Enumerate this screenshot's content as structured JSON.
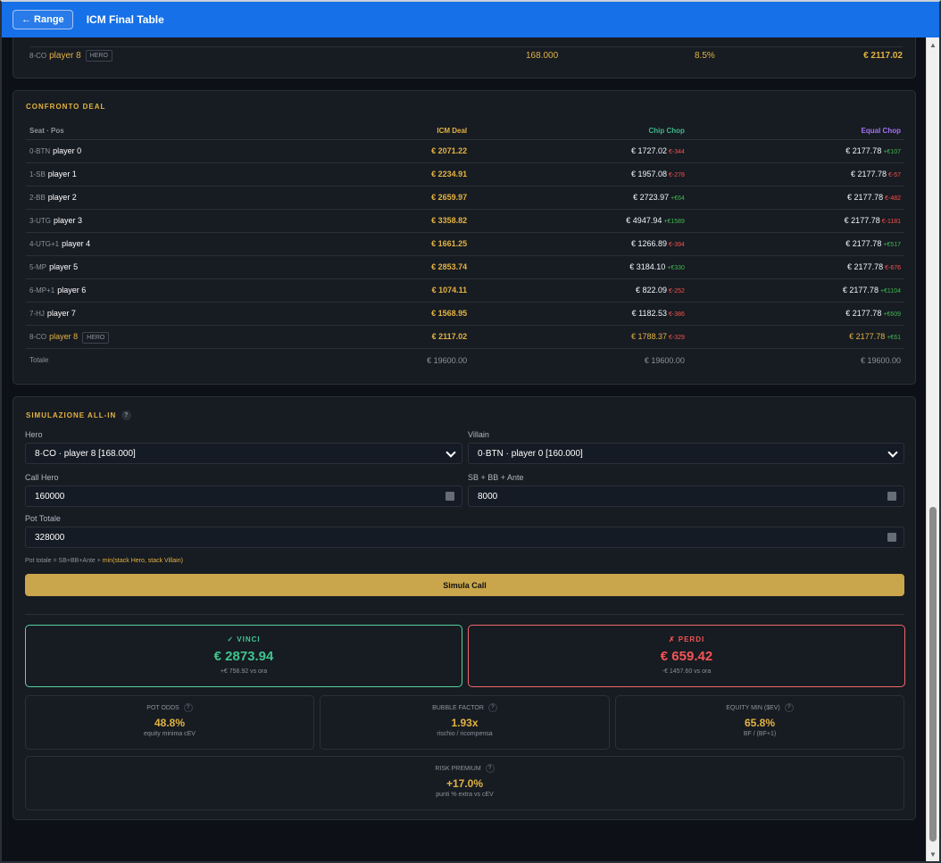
{
  "header": {
    "back": "← Range",
    "title": "ICM Final Table"
  },
  "top_row": {
    "seat": "8-CO",
    "name": "player 8",
    "badge": "HERO",
    "chips": "168.000",
    "percent": "8.5%",
    "value": "€ 2117.02"
  },
  "deal": {
    "title": "CONFRONTO DEAL",
    "columns": [
      "Seat · Pos",
      "ICM Deal",
      "Chip Chop",
      "Equal Chop"
    ],
    "rows": [
      {
        "seat": "0-BTN",
        "name": "player 0",
        "icm": "€ 2071.22",
        "chip": "€ 1727.02",
        "chip_delta": "€-344",
        "equal": "€ 2177.78",
        "equal_delta": "+€107"
      },
      {
        "seat": "1-SB",
        "name": "player 1",
        "icm": "€ 2234.91",
        "chip": "€ 1957.08",
        "chip_delta": "€-278",
        "equal": "€ 2177.78",
        "equal_delta": "€-57"
      },
      {
        "seat": "2-BB",
        "name": "player 2",
        "icm": "€ 2659.97",
        "chip": "€ 2723.97",
        "chip_delta": "+€64",
        "equal": "€ 2177.78",
        "equal_delta": "€-482"
      },
      {
        "seat": "3-UTG",
        "name": "player 3",
        "icm": "€ 3358.82",
        "chip": "€ 4947.94",
        "chip_delta": "+€1589",
        "equal": "€ 2177.78",
        "equal_delta": "€-1181"
      },
      {
        "seat": "4-UTG+1",
        "name": "player 4",
        "icm": "€ 1661.25",
        "chip": "€ 1266.89",
        "chip_delta": "€-394",
        "equal": "€ 2177.78",
        "equal_delta": "+€517"
      },
      {
        "seat": "5-MP",
        "name": "player 5",
        "icm": "€ 2853.74",
        "chip": "€ 3184.10",
        "chip_delta": "+€330",
        "equal": "€ 2177.78",
        "equal_delta": "€-676"
      },
      {
        "seat": "6-MP+1",
        "name": "player 6",
        "icm": "€ 1074.11",
        "chip": "€ 822.09",
        "chip_delta": "€-252",
        "equal": "€ 2177.78",
        "equal_delta": "+€1104"
      },
      {
        "seat": "7-HJ",
        "name": "player 7",
        "icm": "€ 1568.95",
        "chip": "€ 1182.53",
        "chip_delta": "€-386",
        "equal": "€ 2177.78",
        "equal_delta": "+€609"
      },
      {
        "seat": "8-CO",
        "name": "player 8",
        "badge": "HERO",
        "icm": "€ 2117.02",
        "chip": "€ 1788.37",
        "chip_delta": "€-329",
        "equal": "€ 2177.78",
        "equal_delta": "+€61"
      }
    ],
    "total": {
      "label": "Totale",
      "icm": "€ 19600.00",
      "chip": "€ 19600.00",
      "equal": "€ 19600.00"
    }
  },
  "sim": {
    "title": "SIMULAZIONE ALL-IN",
    "help": "?",
    "hero_label": "Hero",
    "hero_value": "8·CO · player 8 [168.000]",
    "villain_label": "Villain",
    "villain_value": "0·BTN · player 0 [160.000]",
    "call_label": "Call Hero",
    "call_value": "160000",
    "blinds_label": "SB + BB + Ante",
    "blinds_value": "8000",
    "pot_label": "Pot Totale",
    "pot_value": "328000",
    "formula_prefix": "Pot totale = SB+BB+Ante + ",
    "formula_highlight": "min(stack Hero, stack Villain)",
    "button": "Simula Call",
    "win_label": "✓ VINCI",
    "win_value": "€ 2873.94",
    "win_note": "+€ 756.92 vs ora",
    "lose_label": "✗ PERDI",
    "lose_value": "€ 659.42",
    "lose_note": "-€ 1457.60 vs ora",
    "metrics": [
      {
        "title": "POT ODDS",
        "value": "48.8%",
        "note": "equity minima cEV"
      },
      {
        "title": "BUBBLE FACTOR",
        "value": "1.93x",
        "note": "rischio / ricompensa"
      },
      {
        "title": "EQUITY MIN ($EV)",
        "value": "65.8%",
        "note": "BF / (BF+1)"
      },
      {
        "title": "RISK PREMIUM",
        "value": "+17.0%",
        "note": "punti % extra vs cEV"
      }
    ]
  },
  "colors": {
    "accent": "#1670e8",
    "gold": "#e3b341",
    "green": "#3fc48f",
    "red": "#f25555",
    "purple": "#a371f7"
  },
  "icons": {
    "back": "arrow-left-icon",
    "dropdown": "chevron-down-icon",
    "spinner": "stepper-icon",
    "help": "question-icon"
  }
}
